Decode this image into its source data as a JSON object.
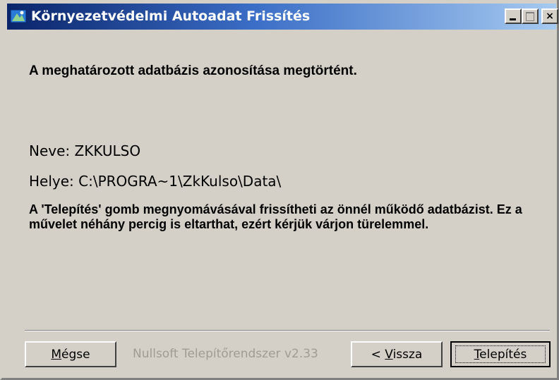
{
  "window": {
    "title": "Környezetvédelmi Autoadat Frissítés",
    "controls": {
      "minimize": "_",
      "maximize": "□",
      "close": "×"
    }
  },
  "content": {
    "heading": "A meghatározott adatbázis azonosítása megtörtént.",
    "name_line": "Neve: ZKKULSO",
    "path_line": "Helye: C:\\PROGRA~1\\ZkKulso\\Data\\",
    "description": "A 'Telepítés' gomb megnyomávásával frissítheti az önnél működő adatbázist. Ez a művelet néhány percig is eltarthat, ezért kérjük várjon türelemmel."
  },
  "footer": {
    "branding": "Nullsoft Telepítőrendszer v2.33",
    "cancel_mnemonic": "M",
    "cancel_rest": "égse",
    "back_prefix": "< ",
    "back_mnemonic": "V",
    "back_rest": "issza",
    "install_mnemonic": "T",
    "install_rest": "elepítés"
  },
  "colors": {
    "titlebar_start": "#0a246a",
    "titlebar_end": "#a6caf0",
    "face": "#d4d0c8",
    "disabled_text": "#a09c94"
  },
  "icons": {
    "app": "installer-icon"
  }
}
